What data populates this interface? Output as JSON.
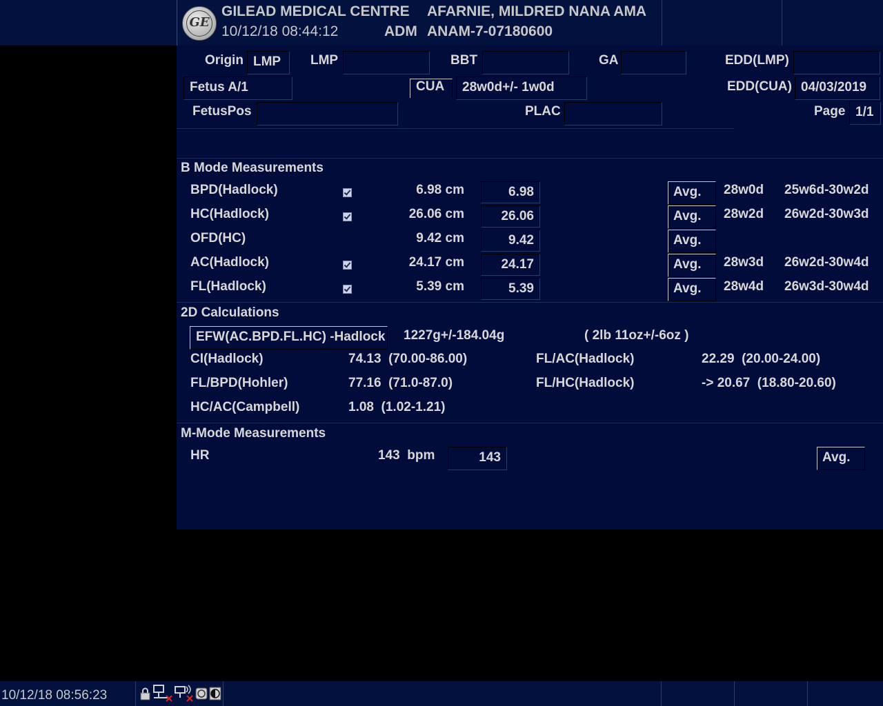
{
  "header": {
    "facility": "GILEAD MEDICAL CENTRE",
    "datetime": "10/12/18 08:44:12",
    "operator": "ADM",
    "patient_name": "AFARNIE, MILDRED NANA AMA",
    "patient_id": "ANAM-7-07180600",
    "logo_text": "GE"
  },
  "info": {
    "origin_label": "Origin",
    "origin_value": "LMP",
    "lmp_label": "LMP",
    "lmp_value": "",
    "bbt_label": "BBT",
    "bbt_value": "",
    "ga_label": "GA",
    "ga_value": "",
    "edd_lmp_label": "EDD(LMP)",
    "edd_lmp_value": "",
    "fetus_value": "Fetus A/1",
    "cua_label": "CUA",
    "cua_value": "28w0d+/- 1w0d",
    "edd_cua_label": "EDD(CUA)",
    "edd_cua_value": "04/03/2019",
    "fetuspos_label": "FetusPos",
    "fetuspos_value": "",
    "plac_label": "PLAC",
    "plac_value": "",
    "page_label": "Page",
    "page_value": "1/1"
  },
  "bmode": {
    "title": "B Mode Measurements",
    "rows": [
      {
        "name": "BPD(Hadlock)",
        "checked": true,
        "measure": "6.98 cm",
        "value": "6.98",
        "avg": "Avg.",
        "ga": "28w0d",
        "range": "25w6d-30w2d"
      },
      {
        "name": "HC(Hadlock)",
        "checked": true,
        "measure": "26.06 cm",
        "value": "26.06",
        "avg": "Avg.",
        "ga": "28w2d",
        "range": "26w2d-30w3d"
      },
      {
        "name": "OFD(HC)",
        "checked": false,
        "measure": "9.42 cm",
        "value": "9.42",
        "avg": "Avg.",
        "ga": "",
        "range": ""
      },
      {
        "name": "AC(Hadlock)",
        "checked": true,
        "measure": "24.17 cm",
        "value": "24.17",
        "avg": "Avg.",
        "ga": "28w3d",
        "range": "26w2d-30w4d"
      },
      {
        "name": "FL(Hadlock)",
        "checked": true,
        "measure": "5.39 cm",
        "value": "5.39",
        "avg": "Avg.",
        "ga": "28w4d",
        "range": "26w3d-30w4d"
      }
    ]
  },
  "calc": {
    "title": "2D Calculations",
    "efw_label": "EFW(AC.BPD.FL.HC) -Hadlock",
    "efw_value": "1227g+/-184.04g",
    "efw_imperial": "( 2lb 11oz+/-6oz )",
    "ci_label": "CI(Hadlock)",
    "ci_value": "74.13  (70.00-86.00)",
    "flac_label": "FL/AC(Hadlock)",
    "flac_value": "22.29  (20.00-24.00)",
    "flbpd_label": "FL/BPD(Hohler)",
    "flbpd_value": "77.16  (71.0-87.0)",
    "flhc_label": "FL/HC(Hadlock)",
    "flhc_value": "-> 20.67  (18.80-20.60)",
    "hcac_label": "HC/AC(Campbell)",
    "hcac_value": "1.08  (1.02-1.21)"
  },
  "mmode": {
    "title": "M-Mode Measurements",
    "hr_label": "HR",
    "hr_measure": "143  bpm",
    "hr_value": "143",
    "avg": "Avg."
  },
  "statusbar": {
    "datetime": "10/12/18 08:56:23"
  },
  "colors": {
    "panel": "#020c3a",
    "header": "#03113f",
    "text": "#d8d8d8"
  }
}
